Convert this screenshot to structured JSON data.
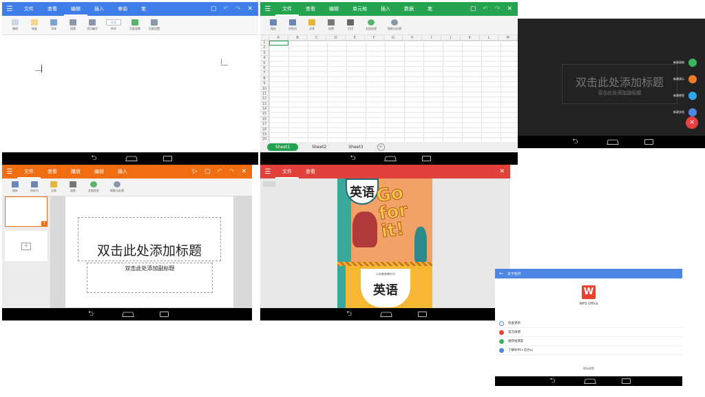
{
  "word": {
    "tabs": [
      "文件",
      "查看",
      "编辑",
      "插入",
      "审阅",
      "笔"
    ],
    "active_tab": "编辑",
    "tools": [
      "撤销",
      "恢复",
      "字体",
      "段落",
      "项目编号",
      "样式",
      "页面背景",
      "页面设置"
    ],
    "style_box": "正文"
  },
  "excel": {
    "tabs": [
      "文件",
      "查看",
      "编辑",
      "单元格",
      "插入",
      "数据",
      "笔"
    ],
    "tools": [
      "保存",
      "另存为",
      "分享",
      "加密",
      "打印",
      "文档信息",
      "帮助与反馈"
    ],
    "columns": [
      "A",
      "B",
      "C",
      "D",
      "E",
      "F",
      "G",
      "H",
      "I",
      "J",
      "K",
      "L",
      "M"
    ],
    "rows": [
      "1",
      "2",
      "3",
      "4",
      "5",
      "6",
      "7",
      "8",
      "9",
      "10",
      "11",
      "12",
      "13",
      "14",
      "15",
      "16",
      "17",
      "18",
      "19",
      "20"
    ],
    "sheets": [
      "Sheet1",
      "Sheet2",
      "Sheet3"
    ],
    "active_sheet": "Sheet1",
    "accent": "#25a350"
  },
  "dark": {
    "title_ph": "双击此处添加标题",
    "subtitle_ph": "双击此处添加副标题",
    "fab_items": [
      {
        "label": "新建表格",
        "color": "#3bb35b"
      },
      {
        "label": "新建演示",
        "color": "#f07a2a"
      },
      {
        "label": "新建便签",
        "color": "#2ea8e8"
      },
      {
        "label": "新建文档",
        "color": "#4e86e6"
      }
    ],
    "close_symbol": "×"
  },
  "ppt": {
    "tabs": [
      "文件",
      "查看",
      "播放",
      "编辑",
      "插入"
    ],
    "tools": [
      "保存",
      "另存为",
      "分享",
      "加密",
      "文档信息",
      "帮助与反馈"
    ],
    "title_ph": "双击此处添加标题",
    "subtitle_ph": "双击此处添加副标题",
    "slide_number": "1",
    "accent": "#f06d11"
  },
  "reader": {
    "tabs": [
      "文件",
      "查看"
    ],
    "cover_title": "英语",
    "cover_slogan": "Go for it!",
    "book_subtitle": "义务教育教科书",
    "accent": "#e0423b"
  },
  "about": {
    "header": "关于软件",
    "app_name": "WPS Office",
    "items": [
      "检查更新",
      "官方微博",
      "推荐给朋友",
      "了解WPS+云办公"
    ],
    "footer": "隐私政策"
  }
}
